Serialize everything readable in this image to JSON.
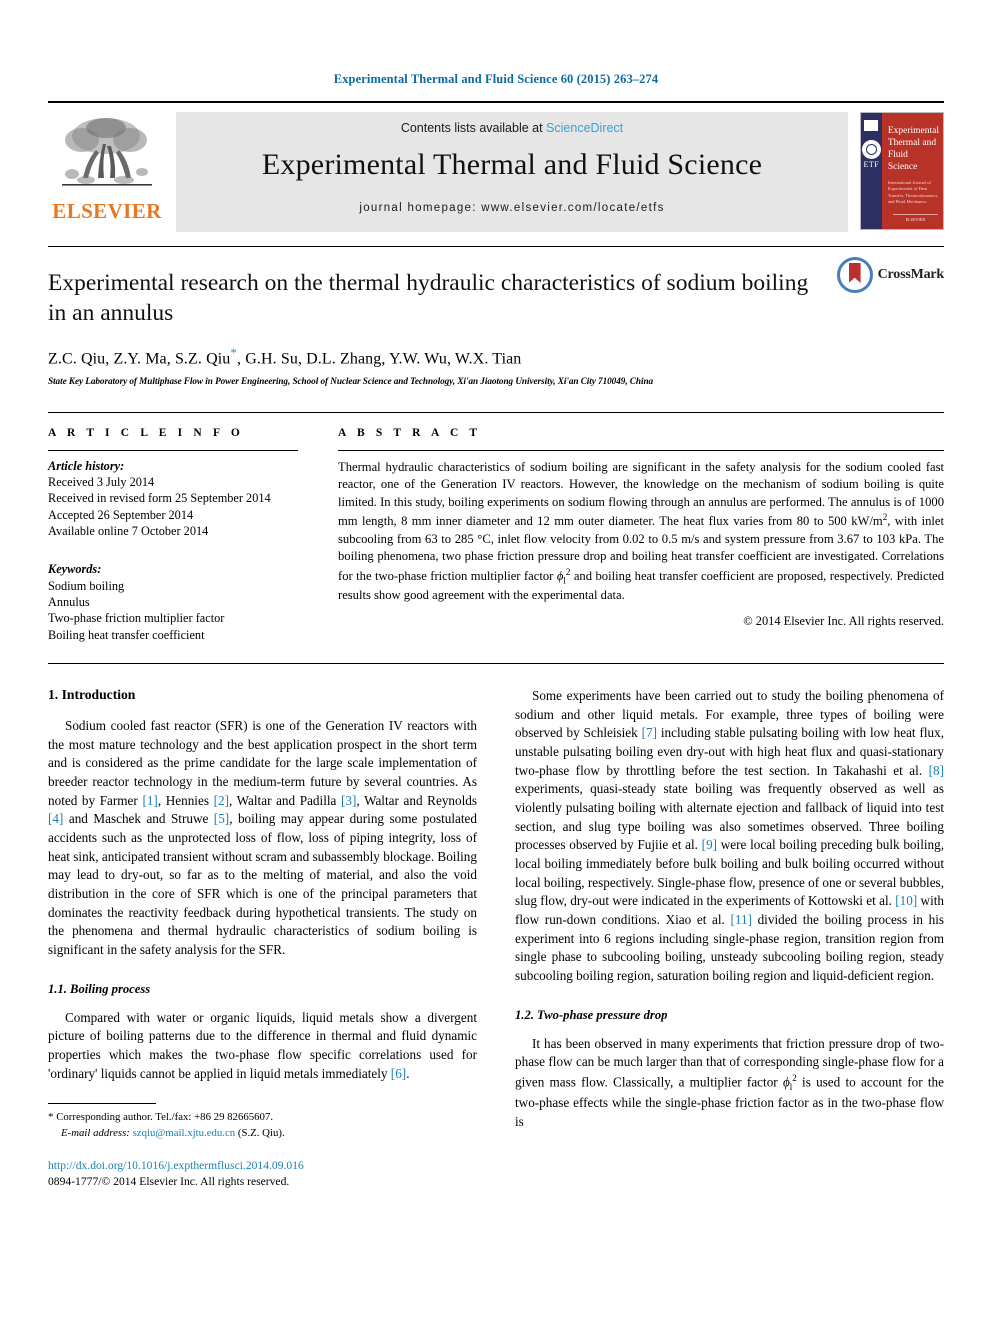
{
  "running_head": "Experimental Thermal and Fluid Science 60 (2015) 263–274",
  "masthead": {
    "publisher_name": "ELSEVIER",
    "contents_prefix": "Contents lists available at ",
    "contents_link": "ScienceDirect",
    "journal_name": "Experimental Thermal and Fluid Science",
    "homepage": "journal homepage: www.elsevier.com/locate/etfs",
    "cover": {
      "title": "Experimental Thermal and Fluid Science",
      "subtitle": "International Journal of Experimental of Heat Transfer, Thermodynamics, and Fluid Mechanics",
      "imprint": "ELSEVIER",
      "etf_label": "ETF"
    }
  },
  "article": {
    "title": "Experimental research on the thermal hydraulic characteristics of sodium boiling in an annulus",
    "authors": "Z.C. Qiu, Z.Y. Ma, S.Z. Qiu",
    "authors_after_star": ", G.H. Su, D.L. Zhang, Y.W. Wu, W.X. Tian",
    "corresponding_marker": "*",
    "affiliation": "State Key Laboratory of Multiphase Flow in Power Engineering, School of Nuclear Science and Technology, Xi'an Jiaotong University, Xi'an City 710049, China",
    "crossmark_label": "CrossMark"
  },
  "info": {
    "heading": "A R T I C L E    I N F O",
    "history_label": "Article history:",
    "history": [
      "Received 3 July 2014",
      "Received in revised form 25 September 2014",
      "Accepted 26 September 2014",
      "Available online 7 October 2014"
    ],
    "keywords_label": "Keywords:",
    "keywords": [
      "Sodium boiling",
      "Annulus",
      "Two-phase friction multiplier factor",
      "Boiling heat transfer coefficient"
    ]
  },
  "abstract": {
    "heading": "A B S T R A C T",
    "text_part1": "Thermal hydraulic characteristics of sodium boiling are significant in the safety analysis for the sodium cooled fast reactor, one of the Generation IV reactors. However, the knowledge on the mechanism of sodium boiling is quite limited. In this study, boiling experiments on sodium flowing through an annulus are performed. The annulus is of 1000 mm length, 8 mm inner diameter and 12 mm outer diameter. The heat flux varies from 80 to 500 kW/m",
    "sup1": "2",
    "text_part2": ", with inlet subcooling from 63 to 285 °C, inlet flow velocity from 0.02 to 0.5 m/s and system pressure from 3.67 to 103 kPa. The boiling phenomena, two phase friction pressure drop and boiling heat transfer coefficient are investigated. Correlations for the two-phase friction multiplier factor ",
    "phi_symbol": "ϕ",
    "phi_sub": "l",
    "phi_sup": "2",
    "text_part3": " and boiling heat transfer coefficient are proposed, respectively. Predicted results show good agreement with the experimental data.",
    "copyright": "© 2014 Elsevier Inc. All rights reserved."
  },
  "body": {
    "section1_heading": "1. Introduction",
    "p1_a": "Sodium cooled fast reactor (SFR) is one of the Generation IV reactors with the most mature technology and the best application prospect in the short term and is considered as the prime candidate for the large scale implementation of breeder reactor technology in the medium-term future by several countries. As noted by Farmer ",
    "p1_r1": "[1]",
    "p1_b": ", Hennies ",
    "p1_r2": "[2]",
    "p1_c": ", Waltar and Padilla ",
    "p1_r3": "[3]",
    "p1_d": ", Waltar and Reynolds ",
    "p1_r4": "[4]",
    "p1_e": " and Maschek and Struwe ",
    "p1_r5": "[5]",
    "p1_f": ", boiling may appear during some postulated accidents such as the unprotected loss of flow, loss of piping integrity, loss of heat sink, anticipated transient without scram and subassembly blockage. Boiling may lead to dry-out, so far as to the melting of material, and also the void distribution in the core of SFR which is one of the principal parameters that dominates the reactivity feedback during hypothetical transients. The study on the phenomena and thermal hydraulic characteristics of sodium boiling is significant in the safety analysis for the SFR.",
    "section11_heading": "1.1. Boiling process",
    "p2_a": "Compared with water or organic liquids, liquid metals show a divergent picture of boiling patterns due to the difference in thermal and fluid dynamic properties which makes the two-phase flow specific correlations used for 'ordinary' liquids cannot be applied in liquid metals immediately ",
    "p2_r1": "[6]",
    "p2_b": ".",
    "p3_a": "Some experiments have been carried out to study the boiling phenomena of sodium and other liquid metals. For example, three types of boiling were observed by Schleisiek ",
    "p3_r1": "[7]",
    "p3_b": " including stable pulsating boiling with low heat flux, unstable pulsating boiling even dry-out with high heat flux and quasi-stationary two-phase flow by throttling before the test section. In Takahashi et al. ",
    "p3_r2": "[8]",
    "p3_c": " experiments, quasi-steady state boiling was frequently observed as well as violently pulsating boiling with alternate ejection and fallback of liquid into test section, and slug type boiling was also sometimes observed. Three boiling processes observed by Fujiie et al. ",
    "p3_r3": "[9]",
    "p3_d": " were local boiling preceding bulk boiling, local boiling immediately before bulk boiling and bulk boiling occurred without local boiling, respectively. Single-phase flow, presence of one or several bubbles, slug flow, dry-out were indicated in the experiments of Kottowski et al. ",
    "p3_r4": "[10]",
    "p3_e": " with flow run-down conditions. Xiao et al. ",
    "p3_r5": "[11]",
    "p3_f": " divided the boiling process in his experiment into 6 regions including single-phase region, transition region from single phase to subcooling boiling, unsteady subcooling boiling region, steady subcooling boiling region, saturation boiling region and liquid-deficient region.",
    "section12_heading": "1.2. Two-phase pressure drop",
    "p4_a": "It has been observed in many experiments that friction pressure drop of two-phase flow can be much larger than that of corresponding single-phase flow for a given mass flow. Classically, a multiplier factor ",
    "p4_phi": "ϕ",
    "p4_phi_sub": "l",
    "p4_phi_sup": "2",
    "p4_b": " is used to account for the two-phase effects while the single-phase friction factor as in the two-phase flow is"
  },
  "footnotes": {
    "star": "*",
    "corresponding": " Corresponding author. Tel./fax: +86 29 82665607.",
    "email_label": "E-mail address:",
    "email": "szqiu@mail.xjtu.edu.cn",
    "email_suffix": " (S.Z. Qiu).",
    "doi": "http://dx.doi.org/10.1016/j.expthermflusci.2014.09.016",
    "issn": "0894-1777/© 2014 Elsevier Inc. All rights reserved."
  },
  "colors": {
    "accent_blue": "#1a7fb5",
    "header_blue": "#0d6aa0",
    "elsevier_orange": "#e87722",
    "sciencedirect_blue": "#3c9fd4",
    "cover_red": "#b83227",
    "cover_navy": "#2b2f62"
  }
}
